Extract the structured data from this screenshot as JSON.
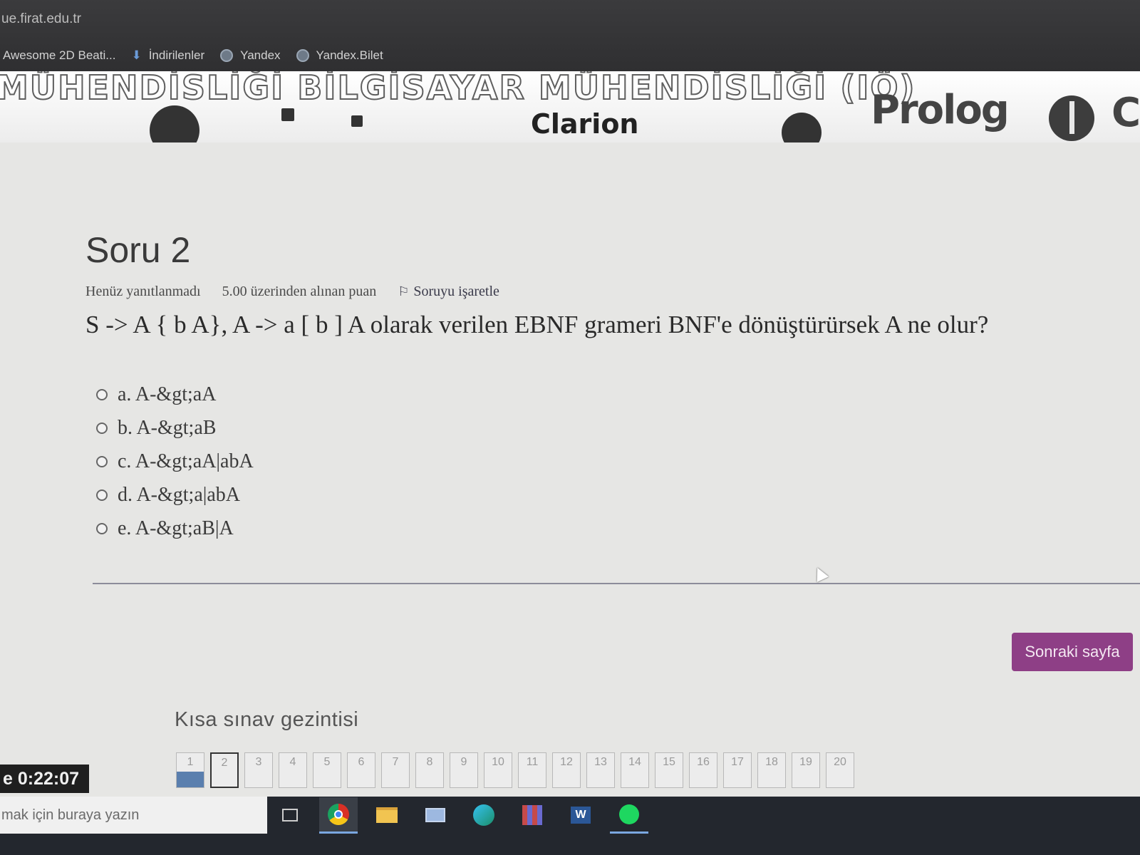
{
  "browser": {
    "url": "ue.firat.edu.tr",
    "bookmarks": [
      {
        "label": "Awesome 2D Beati...",
        "icon": "none"
      },
      {
        "label": "İndirilenler",
        "icon": "download-icon"
      },
      {
        "label": "Yandex",
        "icon": "globe-icon"
      },
      {
        "label": "Yandex.Bilet",
        "icon": "globe-icon"
      }
    ]
  },
  "banner": {
    "heading": "MÜHENDİSLİĞİ BİLGİSAYAR MÜHENDİSLİĞİ (IÖ)",
    "prolog": "Prolog",
    "clarion": "Clarion",
    "c": "C"
  },
  "question": {
    "title": "Soru 2",
    "status": "Henüz yanıtlanmadı",
    "points": "5.00 üzerinden alınan puan",
    "flag_label": "Soruyu işaretle",
    "text": "S -> A { b A}, A -> a [ b ] A olarak verilen EBNF grameri BNF'e dönüştürürsek A ne olur?",
    "answers": [
      "a. A-&gt;aA",
      "b. A-&gt;aB",
      "c. A-&gt;aA|abA",
      "d. A-&gt;a|abA",
      "e. A-&gt;aB|A"
    ]
  },
  "next_button": "Sonraki sayfa",
  "quiz_nav": {
    "title": "Kısa sınav gezintisi",
    "pages": [
      "1",
      "2",
      "3",
      "4",
      "5",
      "6",
      "7",
      "8",
      "9",
      "10",
      "11",
      "12",
      "13",
      "14",
      "15",
      "16",
      "17",
      "18",
      "19",
      "20"
    ],
    "answered": [
      1
    ],
    "current": 2
  },
  "timer": "e 0:22:07",
  "taskbar": {
    "search_placeholder": "mak için buraya yazın"
  },
  "colors": {
    "accent": "#8e3f86",
    "answered": "#5a7fae"
  }
}
